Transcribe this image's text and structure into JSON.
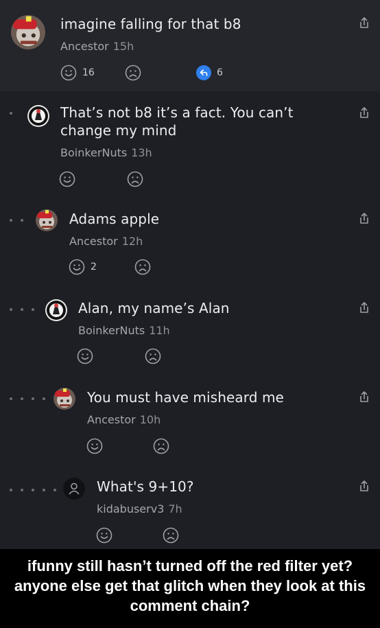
{
  "comments": [
    {
      "text": "imagine falling for that b8",
      "user": "Ancestor",
      "time": "15h",
      "smile_count": "16",
      "replies": "6"
    },
    {
      "text": "That’s not b8 it’s a fact. You can’t change my mind",
      "user": "BoinkerNuts",
      "time": "13h"
    },
    {
      "text": "Adams apple",
      "user": "Ancestor",
      "time": "12h",
      "smile_count": "2"
    },
    {
      "text": "Alan, my name’s Alan",
      "user": "BoinkerNuts",
      "time": "11h"
    },
    {
      "text": "You must have misheard me",
      "user": "Ancestor",
      "time": "10h"
    },
    {
      "text": "What's 9+10?",
      "user": "kidabuserv3",
      "time": "7h"
    }
  ],
  "caption": "ifunny still hasn’t turned off the red filter yet? anyone else get that glitch when they look at this comment chain?",
  "colors": {
    "background": "#1e1f24",
    "op_background": "#25262b",
    "reply_badge": "#2f80ed",
    "icon_gray": "#9ea1a7"
  },
  "icons": {
    "share": "share-icon",
    "smile": "smile-icon",
    "frown": "frown-icon",
    "reply": "reply-icon",
    "default_avatar": "user-icon"
  }
}
